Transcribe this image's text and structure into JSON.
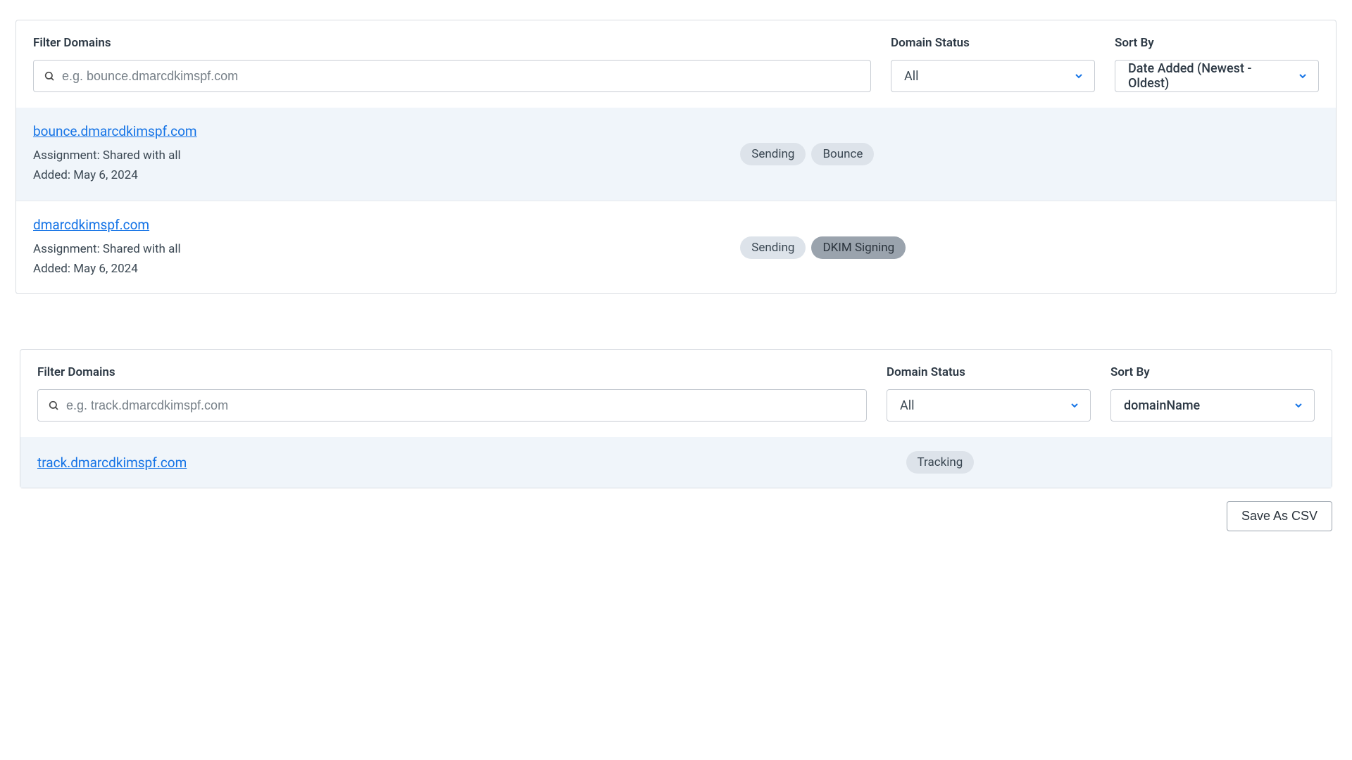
{
  "panel1": {
    "filter_label": "Filter Domains",
    "filter_placeholder": "e.g. bounce.dmarcdkimspf.com",
    "status_label": "Domain Status",
    "status_value": "All",
    "sort_label": "Sort By",
    "sort_value": "Date Added (Newest - Oldest)",
    "rows": [
      {
        "domain": "bounce.dmarcdkimspf.com",
        "assignment": "Assignment: Shared with all",
        "added": "Added: May 6, 2024",
        "badges": [
          "Sending",
          "Bounce"
        ],
        "badge_styles": [
          "",
          ""
        ]
      },
      {
        "domain": "dmarcdkimspf.com",
        "assignment": "Assignment: Shared with all",
        "added": "Added: May 6, 2024",
        "badges": [
          "Sending",
          "DKIM Signing"
        ],
        "badge_styles": [
          "",
          "dark"
        ]
      }
    ]
  },
  "panel2": {
    "filter_label": "Filter Domains",
    "filter_placeholder": "e.g. track.dmarcdkimspf.com",
    "status_label": "Domain Status",
    "status_value": "All",
    "sort_label": "Sort By",
    "sort_value": "domainName",
    "rows": [
      {
        "domain": "track.dmarcdkimspf.com",
        "badges": [
          "Tracking"
        ],
        "badge_styles": [
          ""
        ]
      }
    ]
  },
  "actions": {
    "save_csv_label": "Save As CSV"
  }
}
